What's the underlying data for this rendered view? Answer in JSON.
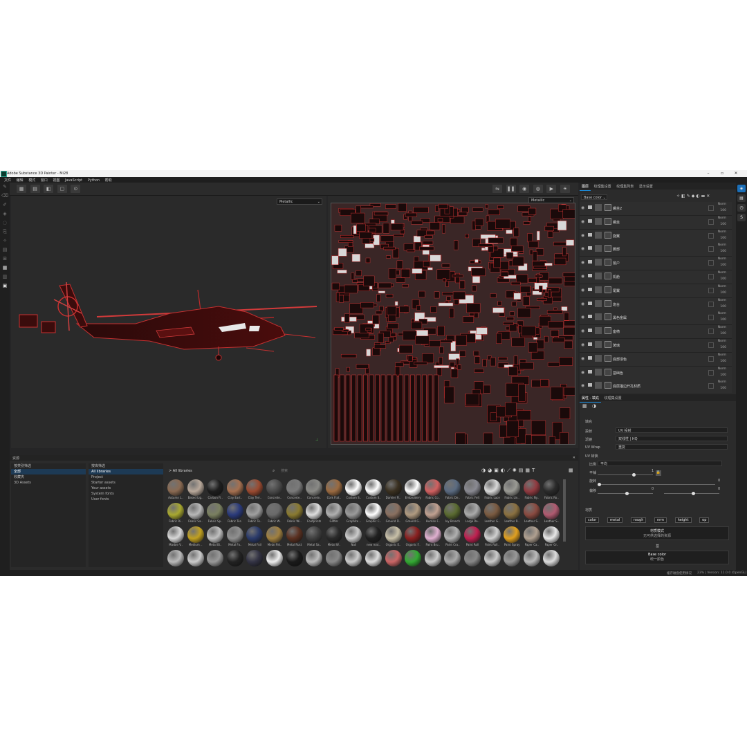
{
  "window": {
    "title": "Adobe Substance 3D Painter - Mi28"
  },
  "menu": [
    "文件",
    "编辑",
    "模式",
    "窗口",
    "视图",
    "JavaScript",
    "Python",
    "帮助"
  ],
  "viewport": {
    "mode_3d": "Metallic",
    "mode_2d": "Metallic"
  },
  "layers_panel": {
    "tabs": [
      "图层",
      "纹理集设置",
      "纹理集列表",
      "显示设置"
    ],
    "channel": "Base color",
    "layers": [
      {
        "name": "螺丝2",
        "blend": "Norm",
        "opacity": "100"
      },
      {
        "name": "螺丝",
        "blend": "Norm",
        "opacity": "100"
      },
      {
        "name": "旋翼",
        "blend": "Norm",
        "opacity": "100"
      },
      {
        "name": "脚部",
        "blend": "Norm",
        "opacity": "100"
      },
      {
        "name": "窗户",
        "blend": "Norm",
        "opacity": "100"
      },
      {
        "name": "机舱",
        "blend": "Norm",
        "opacity": "100"
      },
      {
        "name": "尾翼",
        "blend": "Norm",
        "opacity": "100"
      },
      {
        "name": "炮台",
        "blend": "Norm",
        "opacity": "100"
      },
      {
        "name": "黑色金属",
        "blend": "Norm",
        "opacity": "100"
      },
      {
        "name": "座椅",
        "blend": "Norm",
        "opacity": "100"
      },
      {
        "name": "玻璃",
        "blend": "Norm",
        "opacity": "100"
      },
      {
        "name": "底部漆色",
        "blend": "Norm",
        "opacity": "100"
      },
      {
        "name": "基础色",
        "blend": "Norm",
        "opacity": "100"
      },
      {
        "name": "底层描边开孔材质",
        "blend": "Norm",
        "opacity": "100"
      }
    ]
  },
  "properties_panel": {
    "tabs": [
      "属性 - 填充",
      "纹理集设置"
    ],
    "section_fill": "填充",
    "projection_label": "投射",
    "projection_value": "UV 投射",
    "filter_label": "滤镜",
    "filter_value": "双线性 | HQ",
    "uvwrap_label": "UV Wrap",
    "uvwrap_value": "重复",
    "uv_transform": "UV 转换",
    "scale_label": "比例",
    "scale_value": "平均",
    "tiling_label": "平铺",
    "tiling_value": "1",
    "rotation_label": "旋转",
    "rotation_value": "0",
    "offset_label": "偏移",
    "offset_x": "0",
    "offset_y": "0",
    "section_material": "材质",
    "channels": [
      "color",
      "metal",
      "rough",
      "nrm",
      "height",
      "op"
    ],
    "material_mode_title": "材质模式",
    "material_mode_value": "无可供选择的资源",
    "section_base": "基",
    "base_color_title": "Base color",
    "base_color_value": "统一颜色"
  },
  "shelf": {
    "title": "资源",
    "search_placeholder": "搜索",
    "path_label": "All libraries",
    "col1": [
      "全部",
      "收藏夹",
      "3D Assets"
    ],
    "col1_header": "按类别筛选",
    "col2_header": "按库筛选",
    "col2": [
      "All libraries",
      "Project",
      "Starter assets",
      "Your assets",
      "System fonts",
      "User fonts"
    ],
    "materials": [
      {
        "name": "Autumn L..",
        "color": "#8a6a52"
      },
      {
        "name": "Baked Lig..",
        "color": "#b8a89a"
      },
      {
        "name": "Carbon Fi..",
        "color": "#1e1e1e"
      },
      {
        "name": "Clay Eart..",
        "color": "#a57050"
      },
      {
        "name": "Clay Terr..",
        "color": "#9a4a30"
      },
      {
        "name": "Concrete..",
        "color": "#4a4a4a"
      },
      {
        "name": "Concrete..",
        "color": "#7a7a7a"
      },
      {
        "name": "Concrete..",
        "color": "#8a8a86"
      },
      {
        "name": "Cork Flat..",
        "color": "#9a6a40"
      },
      {
        "name": "Custom S..",
        "color": "#ffffff"
      },
      {
        "name": "Custom S..",
        "color": "#ffffff"
      },
      {
        "name": "Damier Fl..",
        "color": "#3a3020"
      },
      {
        "name": "Embroidery",
        "color": "#ffffff"
      },
      {
        "name": "Fabric Co..",
        "color": "#d06060"
      },
      {
        "name": "Fabric De..",
        "color": "#5a6a80"
      },
      {
        "name": "Fabric Felt",
        "color": "#8a8a92"
      },
      {
        "name": "Fabric Lace",
        "color": "#d8d8d8"
      },
      {
        "name": "Fabric Lin..",
        "color": "#9a9a94"
      },
      {
        "name": "Fabric Ny..",
        "color": "#903a40"
      },
      {
        "name": "Fabric Ro..",
        "color": "#2a2a2a"
      },
      {
        "name": "Fabric Ri..",
        "color": "#a8a830"
      },
      {
        "name": "Fabric Sa..",
        "color": "#b8b8b8"
      },
      {
        "name": "Fabric Sp..",
        "color": "#7a8060"
      },
      {
        "name": "Fabric Ter..",
        "color": "#2a3a7a"
      },
      {
        "name": "Fabric To..",
        "color": "#a0a0a0"
      },
      {
        "name": "Fabric W..",
        "color": "#6a6a6a"
      },
      {
        "name": "Fabric Wi..",
        "color": "#8a7a30"
      },
      {
        "name": "Footprints",
        "color": "#dddddd"
      },
      {
        "name": "Glitter",
        "color": "#b0b0b0"
      },
      {
        "name": "Graphite ..",
        "color": "#9a9a9a"
      },
      {
        "name": "Graphic C..",
        "color": "#ffffff"
      },
      {
        "name": "Ground Fl..",
        "color": "#8a7060"
      },
      {
        "name": "Ground G..",
        "color": "#b09a80"
      },
      {
        "name": "Human F..",
        "color": "#c0a090"
      },
      {
        "name": "Ivy Branch",
        "color": "#5a6a30"
      },
      {
        "name": "Large Ro..",
        "color": "#aaaaaa"
      },
      {
        "name": "Leather G..",
        "color": "#7a5a40"
      },
      {
        "name": "Leather R..",
        "color": "#8a7040"
      },
      {
        "name": "Leather S..",
        "color": "#8a4a40"
      },
      {
        "name": "Leather S..",
        "color": "#b05a70"
      },
      {
        "name": "Marble V..",
        "color": "#d8d8d8"
      },
      {
        "name": "Medium ..",
        "color": "#c0a020"
      },
      {
        "name": "Metal Bi..",
        "color": "#c0c0c0"
      },
      {
        "name": "Metal Fo..",
        "color": "#909090"
      },
      {
        "name": "Metal Foil",
        "color": "#2a3a6a"
      },
      {
        "name": "Metal Pal..",
        "color": "#a08040"
      },
      {
        "name": "Metal Rust",
        "color": "#5a3020"
      },
      {
        "name": "Metal Sa..",
        "color": "#404040"
      },
      {
        "name": "Metal W..",
        "color": "#2a2a2a"
      },
      {
        "name": "Nail",
        "color": "#cccccc"
      },
      {
        "name": "new mat..",
        "color": "#202020"
      },
      {
        "name": "Organic E..",
        "color": "#c8c0a8"
      },
      {
        "name": "Organic F..",
        "color": "#8a2020"
      },
      {
        "name": "Paint Bru..",
        "color": "#e0b0d0"
      },
      {
        "name": "Paint Cra..",
        "color": "#b0b0b0"
      },
      {
        "name": "Paint Roll",
        "color": "#c02050"
      },
      {
        "name": "Paint Roll..",
        "color": "#d0d0d0"
      },
      {
        "name": "Paint Spray",
        "color": "#e0a020"
      },
      {
        "name": "Paper Ca..",
        "color": "#b0a090"
      },
      {
        "name": "Paper Gr..",
        "color": "#e8e8e8"
      }
    ]
  },
  "status": {
    "text": "缓存磁盘使用情况",
    "right": "23% | Version: 11.0.0 (OpenGL)"
  }
}
